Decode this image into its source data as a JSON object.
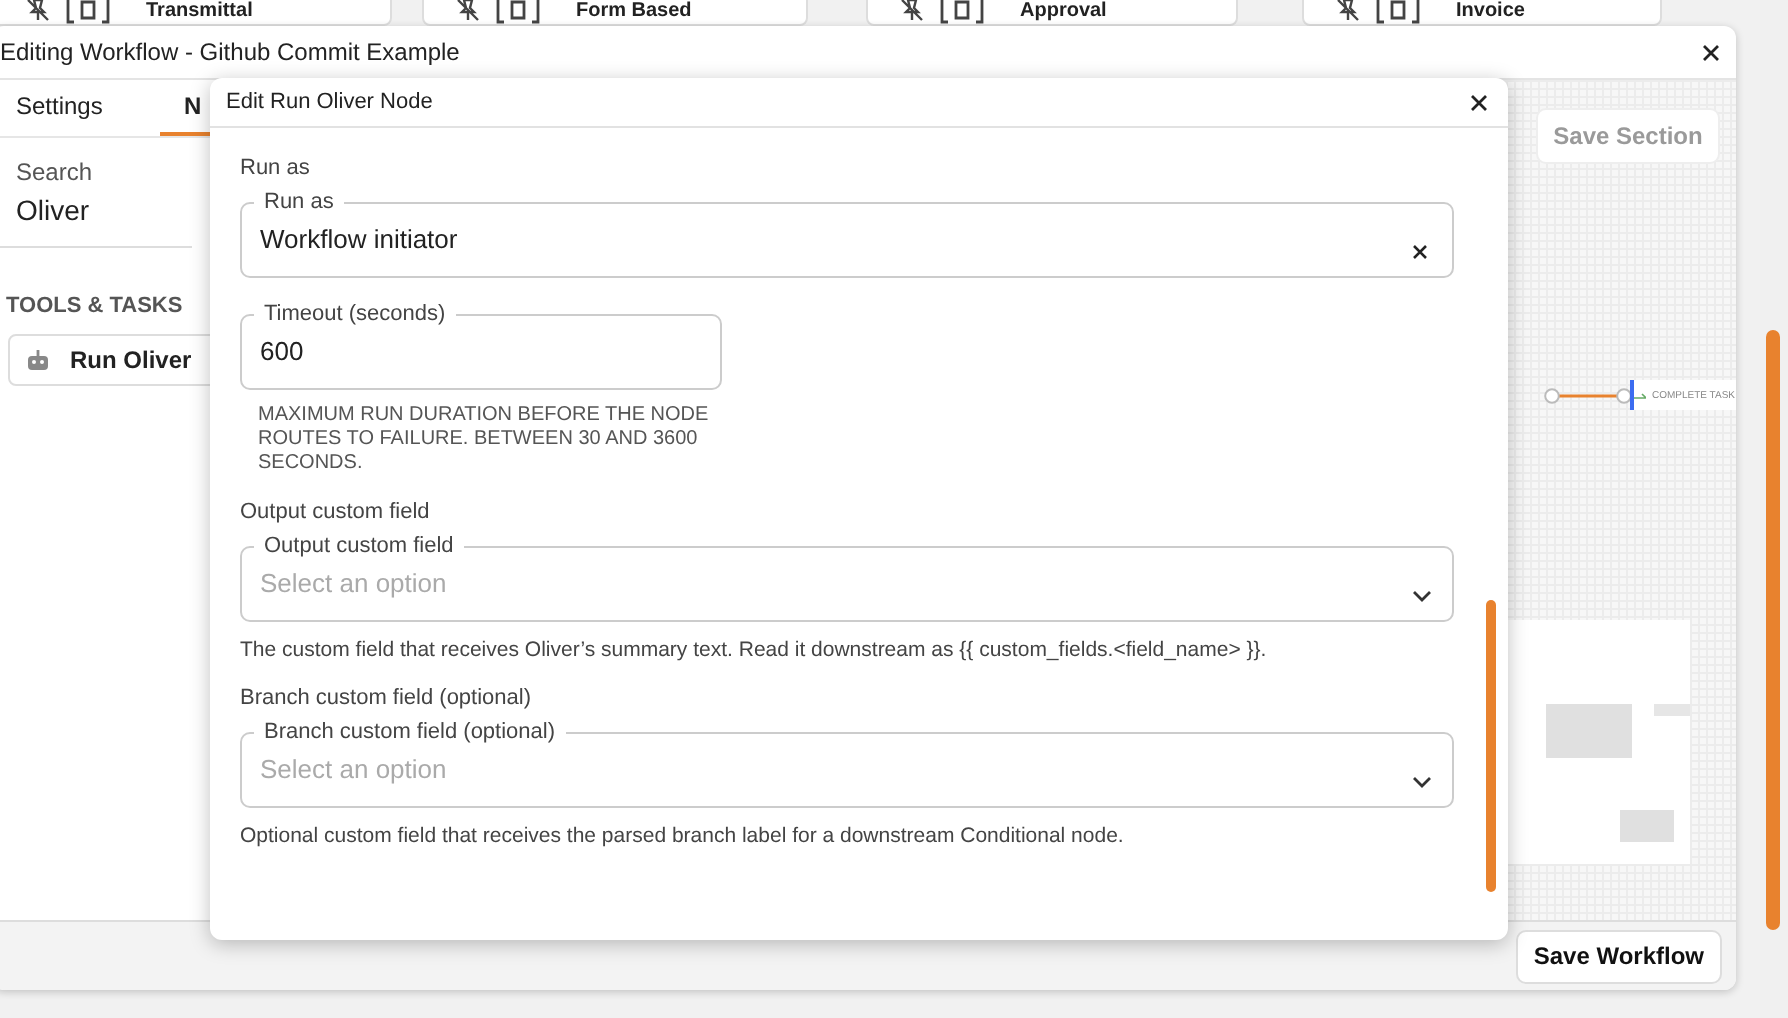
{
  "background_cards": [
    {
      "title": "Transmittal"
    },
    {
      "title": "Form Based"
    },
    {
      "title": "Approval"
    },
    {
      "title": "Invoice"
    }
  ],
  "workflow_window": {
    "title": "Editing Workflow - Github Commit Example",
    "tabs": [
      {
        "label": "Settings",
        "selected": false
      },
      {
        "label": "N",
        "selected": true
      }
    ],
    "search": {
      "label": "Search",
      "value": "Oliver"
    },
    "section_heading": "TOOLS & TASKS",
    "tools": [
      {
        "label": "Run Oliver"
      }
    ],
    "save_section": {
      "label": "Save Section",
      "disabled": true
    },
    "node_label": "COMPLETE TASK",
    "save_button": "Save Workflow"
  },
  "dialog": {
    "title": "Edit Run Oliver Node",
    "fields": [
      {
        "kind": "clearable",
        "section_label": "Run as",
        "label": "Run as",
        "value": "Workflow initiator"
      },
      {
        "kind": "text",
        "label": "Timeout (seconds)",
        "value": "600",
        "note": "MAXIMUM RUN DURATION BEFORE THE NODE ROUTES TO FAILURE. BETWEEN 30 AND 3600 SECONDS."
      },
      {
        "kind": "select",
        "section_label": "Output custom field",
        "label": "Output custom field",
        "placeholder": "Select an option",
        "help": "The custom field that receives Oliver’s summary text. Read it downstream as {{ custom_fields.<field_name> }}."
      },
      {
        "kind": "select",
        "section_label": "Branch custom field (optional)",
        "label": "Branch custom field (optional)",
        "placeholder": "Select an option",
        "help": "Optional custom field that receives the parsed branch label for a downstream Conditional node."
      }
    ]
  }
}
